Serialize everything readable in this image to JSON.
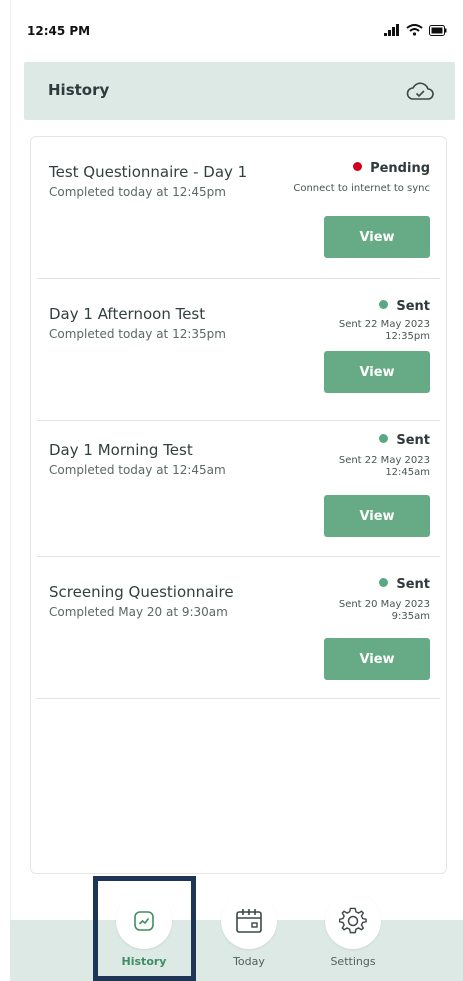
{
  "status_bar": {
    "time": "12:45 PM"
  },
  "header": {
    "title": "History",
    "icon": "cloud-check-icon"
  },
  "entries": [
    {
      "title": "Test Questionnaire - Day 1",
      "subtitle": "Completed today at 12:45pm",
      "status": "Pending",
      "status_color": "#d0021b",
      "note": "Connect to internet to sync",
      "button_label": "View"
    },
    {
      "title": "Day 1 Afternoon Test",
      "subtitle": "Completed today at 12:35pm",
      "status": "Sent",
      "status_color": "#5aa983",
      "note": "Sent 22 May 2023 12:35pm",
      "button_label": "View"
    },
    {
      "title": "Day 1 Morning Test",
      "subtitle": "Completed today at 12:45am",
      "status": "Sent",
      "status_color": "#5aa983",
      "note": "Sent 22 May 2023 12:45am",
      "button_label": "View"
    },
    {
      "title": "Screening Questionnaire",
      "subtitle": "Completed May 20 at 9:30am",
      "status": "Sent",
      "status_color": "#5aa983",
      "note": "Sent 20 May 2023 9:35am",
      "button_label": "View"
    }
  ],
  "tabs": [
    {
      "label": "History",
      "icon": "chart-icon",
      "active": true
    },
    {
      "label": "Today",
      "icon": "calendar-icon",
      "active": false
    },
    {
      "label": "Settings",
      "icon": "gear-icon",
      "active": false
    }
  ],
  "colors": {
    "accent": "#67aa86",
    "header_bg": "#dde9e4",
    "highlight": "#1f3556"
  }
}
